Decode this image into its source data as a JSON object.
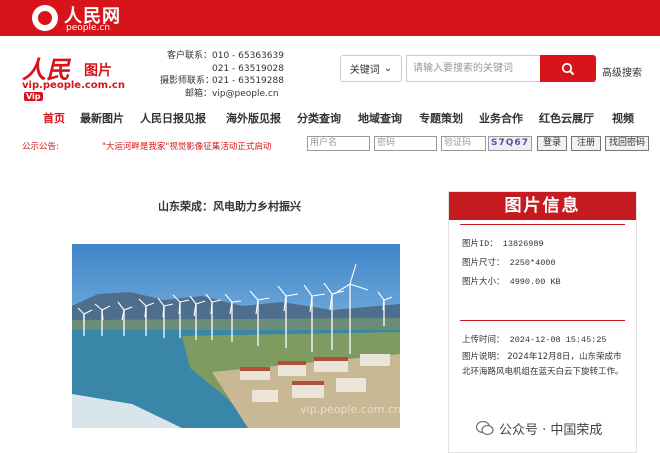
{
  "top_bar": {
    "title": "人民网",
    "subtitle": "people.cn"
  },
  "brand": {
    "main": "人民",
    "sub": "图片",
    "url": "vip.people.com.cn",
    "badge": "Vip"
  },
  "contacts": [
    {
      "label": "客户联系：",
      "value": "010 - 65363639"
    },
    {
      "label": "",
      "value": "021 - 63519028"
    },
    {
      "label": "摄影师联系：",
      "value": "021 - 63519288"
    },
    {
      "label": "邮箱：",
      "value": "vip@people.cn"
    }
  ],
  "search": {
    "select_value": "关键词",
    "placeholder": "请输入要搜索的关键词",
    "advanced": "高级搜索"
  },
  "nav": [
    "首页",
    "最新图片",
    "人民日报见报",
    "海外版见报",
    "分类查询",
    "地域查询",
    "专题策划",
    "业务合作",
    "红色云展厅",
    "视频"
  ],
  "notice": {
    "label": "公示公告:",
    "text": "\"大运河畔是我家\"视觉影像征集活动正式启动"
  },
  "login": {
    "username_placeholder": "用户名",
    "password_placeholder": "密码",
    "captcha_placeholder": "验证码",
    "captcha_image": "S7Q67",
    "login_btn": "登录",
    "register_btn": "注册",
    "recover_btn": "找回密码"
  },
  "article": {
    "title": "山东荣成：风电助力乡村振兴",
    "watermark": "vip.people.com.cn"
  },
  "info": {
    "heading": "图片信息",
    "id": "图片ID： 13826989",
    "size": "图片尺寸： 2250*4000",
    "filesize": "图片大小： 4990.00 KB",
    "upload": "上传时间： 2024-12-08 15:45:25",
    "desc": "图片说明： 2024年12月8日，山东荣成市北环海路风电机组在蓝天白云下旋转工作。"
  },
  "wechat": {
    "text": "公众号 · 中国荣成"
  },
  "colors": {
    "brand_red": "#d8131a",
    "info_red": "#c41a20"
  }
}
